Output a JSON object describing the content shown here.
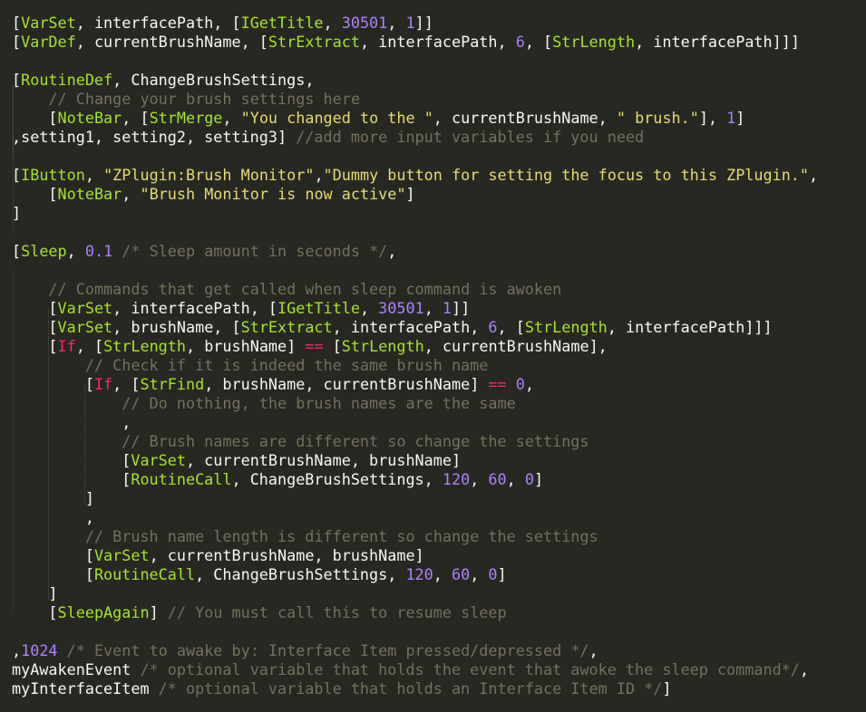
{
  "editor": {
    "colors": {
      "background": "#272822",
      "plain": "#F8F8F2",
      "keyword": "#A6E22E",
      "number": "#AE81FF",
      "string": "#E6DB74",
      "comment": "#75715E",
      "operator": "#F92672"
    },
    "lines": [
      [
        [
          "p",
          "["
        ],
        [
          "k",
          "VarSet"
        ],
        [
          "p",
          ", interfacePath, ["
        ],
        [
          "k",
          "IGetTitle"
        ],
        [
          "p",
          ", "
        ],
        [
          "n",
          "30501"
        ],
        [
          "p",
          ", "
        ],
        [
          "n",
          "1"
        ],
        [
          "p",
          "]]"
        ]
      ],
      [
        [
          "p",
          "["
        ],
        [
          "k",
          "VarDef"
        ],
        [
          "p",
          ", currentBrushName, ["
        ],
        [
          "k",
          "StrExtract"
        ],
        [
          "p",
          ", interfacePath, "
        ],
        [
          "n",
          "6"
        ],
        [
          "p",
          ", ["
        ],
        [
          "k",
          "StrLength"
        ],
        [
          "p",
          ", interfacePath]]]"
        ]
      ],
      [],
      [
        [
          "p",
          "["
        ],
        [
          "k",
          "RoutineDef"
        ],
        [
          "p",
          ", ChangeBrushSettings,"
        ]
      ],
      [
        [
          "p",
          "    "
        ],
        [
          "c",
          "// Change your brush settings here"
        ]
      ],
      [
        [
          "p",
          "    ["
        ],
        [
          "k",
          "NoteBar"
        ],
        [
          "p",
          ", ["
        ],
        [
          "k",
          "StrMerge"
        ],
        [
          "p",
          ", "
        ],
        [
          "s",
          "\"You changed to the \""
        ],
        [
          "p",
          ", currentBrushName, "
        ],
        [
          "s",
          "\" brush.\""
        ],
        [
          "p",
          "], "
        ],
        [
          "n",
          "1"
        ],
        [
          "p",
          "]"
        ]
      ],
      [
        [
          "p",
          ",setting1, setting2, setting3] "
        ],
        [
          "c",
          "//add more input variables if you need"
        ]
      ],
      [],
      [
        [
          "p",
          "["
        ],
        [
          "k",
          "IButton"
        ],
        [
          "p",
          ", "
        ],
        [
          "s",
          "\"ZPlugin:Brush Monitor\""
        ],
        [
          "p",
          ","
        ],
        [
          "s",
          "\"Dummy button for setting the focus to this ZPlugin.\""
        ],
        [
          "p",
          ","
        ]
      ],
      [
        [
          "p",
          "    ["
        ],
        [
          "k",
          "NoteBar"
        ],
        [
          "p",
          ", "
        ],
        [
          "s",
          "\"Brush Monitor is now active\""
        ],
        [
          "p",
          "]"
        ]
      ],
      [
        [
          "p",
          "]"
        ]
      ],
      [],
      [
        [
          "p",
          "["
        ],
        [
          "k",
          "Sleep"
        ],
        [
          "p",
          ", "
        ],
        [
          "n",
          "0.1"
        ],
        [
          "p",
          " "
        ],
        [
          "c",
          "/* Sleep amount in seconds */"
        ],
        [
          "p",
          ","
        ]
      ],
      [],
      [
        [
          "p",
          "    "
        ],
        [
          "c",
          "// Commands that get called when sleep command is awoken"
        ]
      ],
      [
        [
          "p",
          "    ["
        ],
        [
          "k",
          "VarSet"
        ],
        [
          "p",
          ", interfacePath, ["
        ],
        [
          "k",
          "IGetTitle"
        ],
        [
          "p",
          ", "
        ],
        [
          "n",
          "30501"
        ],
        [
          "p",
          ", "
        ],
        [
          "n",
          "1"
        ],
        [
          "p",
          "]]"
        ]
      ],
      [
        [
          "p",
          "    ["
        ],
        [
          "k",
          "VarSet"
        ],
        [
          "p",
          ", brushName, ["
        ],
        [
          "k",
          "StrExtract"
        ],
        [
          "p",
          ", interfacePath, "
        ],
        [
          "n",
          "6"
        ],
        [
          "p",
          ", ["
        ],
        [
          "k",
          "StrLength"
        ],
        [
          "p",
          ", interfacePath]]]"
        ]
      ],
      [
        [
          "p",
          "    ["
        ],
        [
          "o",
          "If"
        ],
        [
          "p",
          ", ["
        ],
        [
          "k",
          "StrLength"
        ],
        [
          "p",
          ", brushName] "
        ],
        [
          "o",
          "=="
        ],
        [
          "p",
          " ["
        ],
        [
          "k",
          "StrLength"
        ],
        [
          "p",
          ", currentBrushName],"
        ]
      ],
      [
        [
          "p",
          "        "
        ],
        [
          "c",
          "// Check if it is indeed the same brush name"
        ]
      ],
      [
        [
          "p",
          "        ["
        ],
        [
          "o",
          "If"
        ],
        [
          "p",
          ", ["
        ],
        [
          "k",
          "StrFind"
        ],
        [
          "p",
          ", brushName, currentBrushName] "
        ],
        [
          "o",
          "=="
        ],
        [
          "p",
          " "
        ],
        [
          "n",
          "0"
        ],
        [
          "p",
          ","
        ]
      ],
      [
        [
          "p",
          "            "
        ],
        [
          "c",
          "// Do nothing, the brush names are the same"
        ]
      ],
      [
        [
          "p",
          "            ,"
        ]
      ],
      [
        [
          "p",
          "            "
        ],
        [
          "c",
          "// Brush names are different so change the settings"
        ]
      ],
      [
        [
          "p",
          "            ["
        ],
        [
          "k",
          "VarSet"
        ],
        [
          "p",
          ", currentBrushName, brushName]"
        ]
      ],
      [
        [
          "p",
          "            ["
        ],
        [
          "k",
          "RoutineCall"
        ],
        [
          "p",
          ", ChangeBrushSettings, "
        ],
        [
          "n",
          "120"
        ],
        [
          "p",
          ", "
        ],
        [
          "n",
          "60"
        ],
        [
          "p",
          ", "
        ],
        [
          "n",
          "0"
        ],
        [
          "p",
          "]"
        ]
      ],
      [
        [
          "p",
          "        ]"
        ]
      ],
      [
        [
          "p",
          "        ,"
        ]
      ],
      [
        [
          "p",
          "        "
        ],
        [
          "c",
          "// Brush name length is different so change the settings"
        ]
      ],
      [
        [
          "p",
          "        ["
        ],
        [
          "k",
          "VarSet"
        ],
        [
          "p",
          ", currentBrushName, brushName]"
        ]
      ],
      [
        [
          "p",
          "        ["
        ],
        [
          "k",
          "RoutineCall"
        ],
        [
          "p",
          ", ChangeBrushSettings, "
        ],
        [
          "n",
          "120"
        ],
        [
          "p",
          ", "
        ],
        [
          "n",
          "60"
        ],
        [
          "p",
          ", "
        ],
        [
          "n",
          "0"
        ],
        [
          "p",
          "]"
        ]
      ],
      [
        [
          "p",
          "    ]"
        ]
      ],
      [
        [
          "p",
          "    ["
        ],
        [
          "k",
          "SleepAgain"
        ],
        [
          "p",
          "] "
        ],
        [
          "c",
          "// You must call this to resume sleep"
        ]
      ],
      [],
      [
        [
          "p",
          ","
        ],
        [
          "n",
          "1024"
        ],
        [
          "p",
          " "
        ],
        [
          "c",
          "/* Event to awake by: Interface Item pressed/depressed */"
        ],
        [
          "p",
          ","
        ]
      ],
      [
        [
          "p",
          "myAwakenEvent "
        ],
        [
          "c",
          "/* optional variable that holds the event that awoke the sleep command*/"
        ],
        [
          "p",
          ","
        ]
      ],
      [
        [
          "p",
          "myInterfaceItem "
        ],
        [
          "c",
          "/* optional variable that holds an Interface Item ID */"
        ],
        [
          "p",
          "]"
        ]
      ]
    ]
  }
}
